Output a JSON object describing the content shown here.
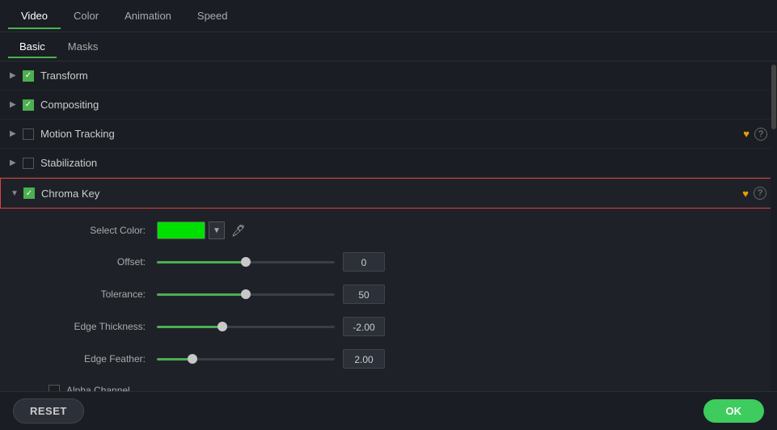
{
  "tabs": {
    "main": [
      {
        "id": "video",
        "label": "Video",
        "active": true
      },
      {
        "id": "color",
        "label": "Color",
        "active": false
      },
      {
        "id": "animation",
        "label": "Animation",
        "active": false
      },
      {
        "id": "speed",
        "label": "Speed",
        "active": false
      }
    ],
    "sub": [
      {
        "id": "basic",
        "label": "Basic",
        "active": true
      },
      {
        "id": "masks",
        "label": "Masks",
        "active": false
      }
    ]
  },
  "sections": [
    {
      "id": "transform",
      "label": "Transform",
      "checked": true,
      "expanded": false,
      "hasHeart": false,
      "hasQuestion": false
    },
    {
      "id": "compositing",
      "label": "Compositing",
      "checked": true,
      "expanded": false,
      "hasHeart": false,
      "hasQuestion": false
    },
    {
      "id": "motion-tracking",
      "label": "Motion Tracking",
      "checked": false,
      "expanded": false,
      "hasHeart": true,
      "hasQuestion": true
    },
    {
      "id": "stabilization",
      "label": "Stabilization",
      "checked": false,
      "expanded": false,
      "hasHeart": false,
      "hasQuestion": false
    },
    {
      "id": "chroma-key",
      "label": "Chroma Key",
      "checked": true,
      "expanded": true,
      "hasHeart": true,
      "hasQuestion": true
    }
  ],
  "chroma_key": {
    "select_color_label": "Select Color:",
    "color_value": "#00e000",
    "offset_label": "Offset:",
    "offset_value": "0",
    "offset_percent": 50,
    "tolerance_label": "Tolerance:",
    "tolerance_value": "50",
    "tolerance_percent": 50,
    "edge_thickness_label": "Edge Thickness:",
    "edge_thickness_value": "-2.00",
    "edge_thickness_percent": 37,
    "edge_feather_label": "Edge Feather:",
    "edge_feather_value": "2.00",
    "edge_feather_percent": 20,
    "alpha_channel_label": "Alpha Channel",
    "alpha_checked": false
  },
  "buttons": {
    "reset": "RESET",
    "ok": "OK"
  }
}
